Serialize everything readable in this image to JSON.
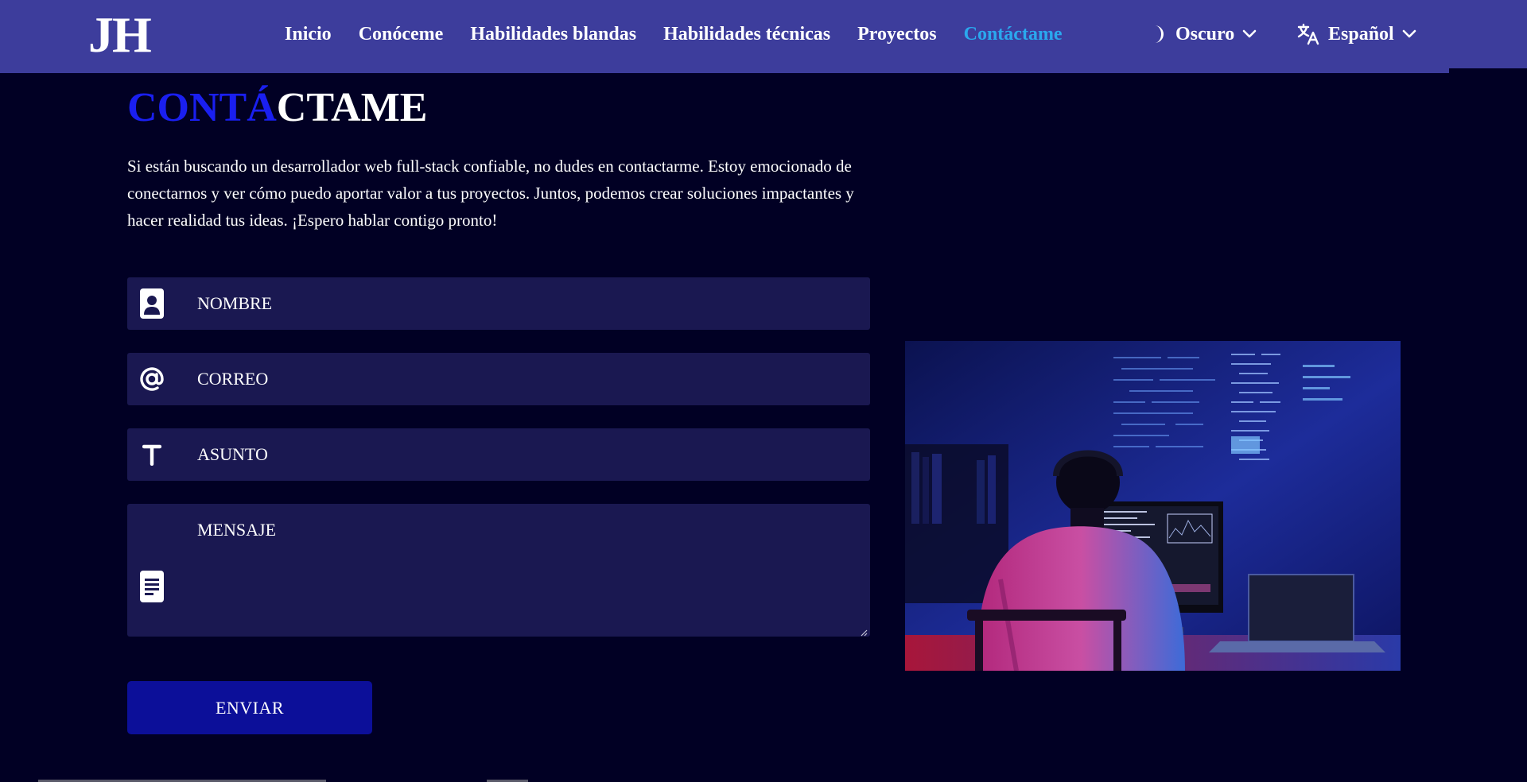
{
  "header": {
    "logo": "JH",
    "nav": [
      {
        "label": "Inicio"
      },
      {
        "label": "Conóceme"
      },
      {
        "label": "Habilidades blandas"
      },
      {
        "label": "Habilidades técnicas"
      },
      {
        "label": "Proyectos"
      },
      {
        "label": "Contáctame",
        "active": true
      }
    ],
    "theme_label": "Oscuro",
    "theme_icon": "half-moon-icon",
    "language_label": "Español",
    "language_icon": "translate-icon"
  },
  "contact": {
    "title_accent": "CONTÁ",
    "title_rest": "CTAME",
    "intro": "Si están buscando un desarrollador web full-stack confiable, no dudes en contactarme. Estoy emocionado de conectarnos y ver cómo puedo aportar valor a tus proyectos. Juntos, podemos crear soluciones impactantes y hacer realidad tus ideas. ¡Espero hablar contigo pronto!",
    "fields": {
      "name_placeholder": "NOMBRE",
      "email_placeholder": "CORREO",
      "subject_placeholder": "ASUNTO",
      "message_placeholder": "MENSAJE"
    },
    "submit_label": "ENVIAR"
  },
  "colors": {
    "background": "#010024",
    "navbar": "#3d3d9c",
    "active_nav": "#2aa8ee",
    "title_accent": "#1a1ff0",
    "field_bg": "#1a1851",
    "button_bg": "#0c0f99"
  }
}
